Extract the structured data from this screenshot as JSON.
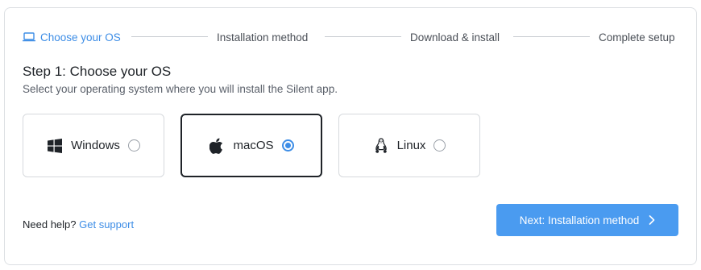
{
  "stepper": {
    "steps": [
      {
        "label": "Choose your OS",
        "icon": "laptop-icon",
        "active": true
      },
      {
        "label": "Installation method",
        "active": false
      },
      {
        "label": "Download & install",
        "active": false
      },
      {
        "label": "Complete setup",
        "active": false
      }
    ]
  },
  "heading": "Step 1: Choose your OS",
  "subheading": "Select your operating system where you will install the Silent app.",
  "os_options": [
    {
      "label": "Windows",
      "icon": "windows-icon",
      "selected": false
    },
    {
      "label": "macOS",
      "icon": "apple-icon",
      "selected": true
    },
    {
      "label": "Linux",
      "icon": "linux-tux-icon",
      "selected": false
    }
  ],
  "help": {
    "prefix": "Need help?",
    "link": "Get support"
  },
  "next_button": {
    "label": "Next: Installation method",
    "icon": "chevron-right-icon"
  },
  "colors": {
    "accent": "#3d8de6",
    "button": "#4a9bf0",
    "text": "#1f2328",
    "muted": "#5b616b"
  }
}
